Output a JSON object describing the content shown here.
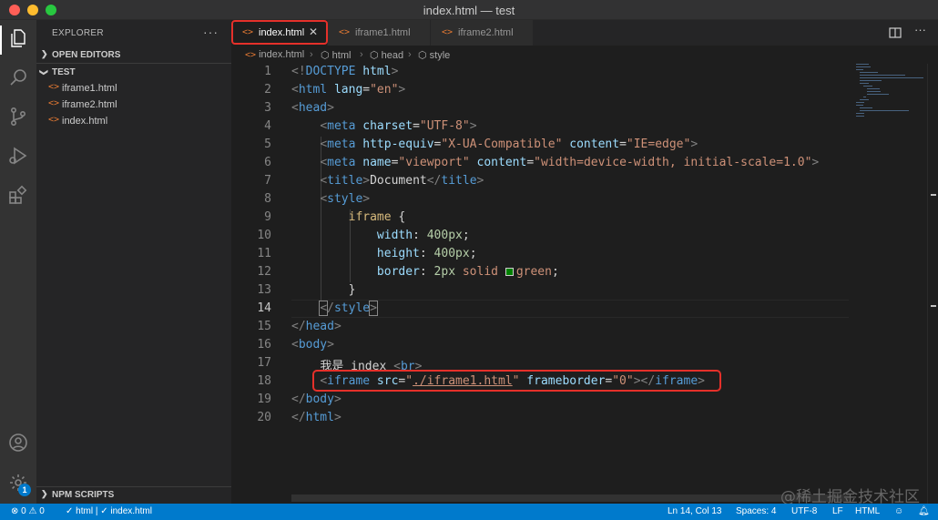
{
  "window": {
    "title": "index.html — test"
  },
  "explorer": {
    "header": "EXPLORER",
    "more_label": "···",
    "open_editors": "OPEN EDITORS",
    "folder": "TEST",
    "files": [
      "iframe1.html",
      "iframe2.html",
      "index.html"
    ],
    "npm_scripts": "NPM SCRIPTS",
    "badge_count": "1"
  },
  "tabs": [
    {
      "label": "index.html",
      "active": true
    },
    {
      "label": "iframe1.html",
      "active": false
    },
    {
      "label": "iframe2.html",
      "active": false
    }
  ],
  "breadcrumbs": [
    "index.html",
    "html",
    "head",
    "style"
  ],
  "editor": {
    "line_numbers": [
      "1",
      "2",
      "3",
      "4",
      "5",
      "6",
      "7",
      "8",
      "9",
      "10",
      "11",
      "12",
      "13",
      "14",
      "15",
      "16",
      "17",
      "18",
      "19",
      "20"
    ],
    "active_line": "14",
    "lines": {
      "l1": [
        "<!",
        "DOCTYPE",
        " html",
        ">"
      ],
      "l2": [
        "<",
        "html",
        " lang",
        "=",
        "\"en\"",
        ">"
      ],
      "l3": [
        "<",
        "head",
        ">"
      ],
      "l4": [
        "<",
        "meta",
        " charset",
        "=",
        "\"UTF-8\"",
        ">"
      ],
      "l5": [
        "<",
        "meta",
        " http-equiv",
        "=",
        "\"X-UA-Compatible\"",
        " content",
        "=",
        "\"IE=edge\"",
        ">"
      ],
      "l6": [
        "<",
        "meta",
        " name",
        "=",
        "\"viewport\"",
        " content",
        "=",
        "\"width=device-width, initial-scale=1.0\"",
        ">"
      ],
      "l7": [
        "<",
        "title",
        ">",
        "Document",
        "</",
        "title",
        ">"
      ],
      "l8": [
        "<",
        "style",
        ">"
      ],
      "l9": [
        "iframe",
        " {"
      ],
      "l10": [
        "width",
        ": ",
        "400px",
        ";"
      ],
      "l11": [
        "height",
        ": ",
        "400px",
        ";"
      ],
      "l12": [
        "border",
        ": ",
        "2px",
        " solid ",
        "green",
        ";"
      ],
      "l13": [
        "}"
      ],
      "l14": [
        "<",
        "/",
        "style",
        ">"
      ],
      "l15": [
        "</",
        "head",
        ">"
      ],
      "l16": [
        "<",
        "body",
        ">"
      ],
      "l17": [
        "我是 index ",
        "<",
        "br",
        ">"
      ],
      "l18": [
        "<",
        "iframe",
        " src",
        "=",
        "\"",
        "./iframe1.html",
        "\"",
        " frameborder",
        "=",
        "\"0\"",
        "></",
        "iframe",
        ">"
      ],
      "l19": [
        "</",
        "body",
        ">"
      ],
      "l20": [
        "</",
        "html",
        ">"
      ]
    }
  },
  "status": {
    "errors": "0",
    "warnings": "0",
    "lang_check": "html | ✓ index.html",
    "cursor": "Ln 14, Col 13",
    "spaces": "Spaces: 4",
    "encoding": "UTF-8",
    "eol": "LF",
    "language": "HTML"
  },
  "watermark": "@稀土掘金技术社区",
  "colors": {
    "accent": "#007acc",
    "highlight": "#e5302a",
    "tag": "#569cd6",
    "attr": "#9cdcfe",
    "string": "#ce9178"
  }
}
